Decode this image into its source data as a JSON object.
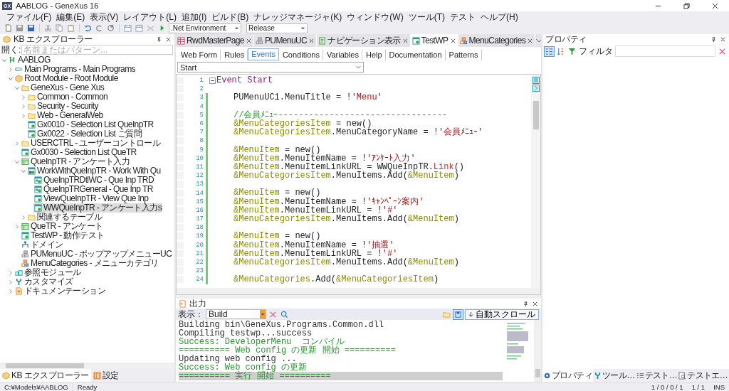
{
  "window": {
    "app_icon": "GX",
    "title": "AABLOG - GeneXus 16"
  },
  "menu": [
    "ファイル(F)",
    "編集(E)",
    "表示(V)",
    "レイアウト(L)",
    "追加(I)",
    "ビルド(B)",
    "ナレッジマネージャ(K)",
    "ウィンドウ(W)",
    "ツール(T)",
    "テスト",
    "ヘルプ(H)"
  ],
  "toolbar": {
    "environment": ".Net Environment",
    "configuration": "Release"
  },
  "kb_explorer": {
    "title": "KB エクスプローラー",
    "search_label": "開く:",
    "search": {
      "placeholder": "名前またはパターン..."
    },
    "tree": [
      {
        "label": "AABLOG",
        "kind": "kb",
        "expanded": true,
        "selected": false,
        "children": [
          {
            "label": "Main Programs - Main Programs",
            "kind": "mainprog",
            "expanded": false,
            "selected": false
          },
          {
            "label": "Root Module - Root Module",
            "kind": "module",
            "expanded": true,
            "selected": false,
            "children": [
              {
                "label": "GeneXus - Gene Xus",
                "kind": "folder",
                "expanded": true,
                "selected": false,
                "children": [
                  {
                    "label": "Common - Common",
                    "kind": "folder",
                    "expanded": false,
                    "selected": false
                  },
                  {
                    "label": "Security - Security",
                    "kind": "folder",
                    "expanded": false,
                    "selected": false
                  },
                  {
                    "label": "Web - GeneralWeb",
                    "kind": "folder",
                    "expanded": false,
                    "selected": false
                  },
                  {
                    "label": "Gx0010 - Selection List QueInpTR",
                    "kind": "webpanel",
                    "selected": false
                  },
                  {
                    "label": "Gx0022 - Selection List ご質問",
                    "kind": "webpanel",
                    "selected": false
                  }
                ]
              },
              {
                "label": "USERCTRL - ユーザーコントロール",
                "kind": "folder",
                "expanded": false,
                "selected": false
              },
              {
                "label": "Gx0030 - Selection List QueTR",
                "kind": "webpanel",
                "selected": false
              },
              {
                "label": "QueInpTR - アンケート入力",
                "kind": "transaction",
                "expanded": true,
                "selected": false,
                "children": [
                  {
                    "label": "WorkWithQueInpTR - Work With Qu",
                    "kind": "pattern",
                    "expanded": true,
                    "selected": false,
                    "children": [
                      {
                        "label": "QueInpTRDtlWC - Que Inp TRD",
                        "kind": "webcomponent",
                        "selected": false
                      },
                      {
                        "label": "QueInpTRGeneral - Que Inp TR",
                        "kind": "webcomponent",
                        "selected": false
                      },
                      {
                        "label": "ViewQueInpTR - View Que Inp",
                        "kind": "webpanel",
                        "selected": false
                      },
                      {
                        "label": "WWQueInpTR - アンケート入力s",
                        "kind": "webpanel",
                        "selected": true
                      }
                    ]
                  },
                  {
                    "label": "関連するテーブル",
                    "kind": "folder",
                    "expanded": false,
                    "selected": false
                  }
                ]
              },
              {
                "label": "QueTR - アンケート",
                "kind": "transaction",
                "expanded": false,
                "selected": false
              },
              {
                "label": "TestWP - 動作テスト",
                "kind": "webpanel",
                "selected": false
              },
              {
                "label": "ドメイン",
                "kind": "domain",
                "selected": false
              },
              {
                "label": "PUMenuUC - ポップアップメニューUC",
                "kind": "uc",
                "selected": false
              },
              {
                "label": "MenuCategories - メニューカテゴリ",
                "kind": "sdt",
                "selected": false
              }
            ]
          },
          {
            "label": "参照モジュール",
            "kind": "refmodule",
            "expanded": false,
            "selected": false
          },
          {
            "label": "カスタマイズ",
            "kind": "customize",
            "expanded": false,
            "selected": false
          },
          {
            "label": "ドキュメンテーション",
            "kind": "doc",
            "expanded": false,
            "selected": false
          }
        ]
      }
    ]
  },
  "left_tabs": [
    {
      "label": "KB エクスプローラー",
      "kind": "kb",
      "selected": true
    },
    {
      "label": "設定",
      "kind": "settings",
      "selected": false
    }
  ],
  "document_tabs": [
    {
      "label": "RwdMasterPage",
      "kind": "masterpage",
      "selected": false
    },
    {
      "label": "PUMenuUC",
      "kind": "uc",
      "selected": false
    },
    {
      "label": "ナビゲーション表示",
      "kind": "navigation",
      "selected": false
    },
    {
      "label": "TestWP",
      "kind": "webpanel",
      "selected": true
    },
    {
      "label": "MenuCategories",
      "kind": "sdt",
      "selected": false
    }
  ],
  "section_tabs": [
    {
      "label": "Web Form",
      "selected": false
    },
    {
      "label": "Rules",
      "selected": false
    },
    {
      "label": "Events",
      "selected": true
    },
    {
      "label": "Conditions",
      "selected": false
    },
    {
      "label": "Variables",
      "selected": false
    },
    {
      "label": "Help",
      "selected": false
    },
    {
      "label": "Documentation",
      "selected": false
    },
    {
      "label": "Patterns",
      "selected": false
    }
  ],
  "event_selector": {
    "value": "Start"
  },
  "code": [
    {
      "number": "1",
      "kind": "header",
      "changed": false,
      "tokens": [
        {
          "kind": "keyword",
          "text": "Event Start"
        }
      ]
    },
    {
      "number": "2",
      "kind": "body",
      "changed": false
    },
    {
      "number": "3",
      "kind": "body",
      "changed": true,
      "tokens": [
        {
          "kind": "plain",
          "text": "PUMenuUC1.MenuTitle = !"
        },
        {
          "kind": "string",
          "text": "'Menu'"
        }
      ]
    },
    {
      "number": "4",
      "kind": "body",
      "changed": true
    },
    {
      "number": "5",
      "kind": "body",
      "changed": true,
      "tokens": [
        {
          "kind": "comment",
          "text": "//会員ﾒﾆｭｰ---------------------------------"
        }
      ]
    },
    {
      "number": "6",
      "kind": "body",
      "changed": true,
      "tokens": [
        {
          "kind": "var",
          "text": "&MenuCategoriesItem"
        },
        {
          "kind": "plain",
          "text": " = new()"
        }
      ]
    },
    {
      "number": "7",
      "kind": "body",
      "changed": true,
      "tokens": [
        {
          "kind": "var",
          "text": "&MenuCategoriesItem"
        },
        {
          "kind": "plain",
          "text": ".MenuCategoryName = !"
        },
        {
          "kind": "string",
          "text": "'会員ﾒﾆｭｰ'"
        }
      ]
    },
    {
      "number": "8",
      "kind": "body",
      "changed": true
    },
    {
      "number": "9",
      "kind": "body",
      "changed": true,
      "tokens": [
        {
          "kind": "var",
          "text": "&MenuItem"
        },
        {
          "kind": "plain",
          "text": " = new()"
        }
      ]
    },
    {
      "number": "10",
      "kind": "body",
      "changed": true,
      "tokens": [
        {
          "kind": "var",
          "text": "&MenuItem"
        },
        {
          "kind": "plain",
          "text": ".MenuItemName = !"
        },
        {
          "kind": "string",
          "text": "'ｱﾝｹｰﾄ入力'"
        }
      ]
    },
    {
      "number": "11",
      "kind": "body",
      "changed": true,
      "tokens": [
        {
          "kind": "var",
          "text": "&MenuItem"
        },
        {
          "kind": "plain",
          "text": ".MenuItemLinkURL = WWQueInpTR."
        },
        {
          "kind": "method",
          "text": "Link"
        },
        {
          "kind": "plain",
          "text": "()"
        }
      ]
    },
    {
      "number": "12",
      "kind": "body",
      "changed": true,
      "tokens": [
        {
          "kind": "var",
          "text": "&MenuCategoriesItem"
        },
        {
          "kind": "plain",
          "text": ".MenuItems.Add("
        },
        {
          "kind": "var",
          "text": "&MenuItem"
        },
        {
          "kind": "plain",
          "text": ")"
        }
      ]
    },
    {
      "number": "13",
      "kind": "body",
      "changed": true
    },
    {
      "number": "14",
      "kind": "body",
      "changed": true,
      "tokens": [
        {
          "kind": "var",
          "text": "&MenuItem"
        },
        {
          "kind": "plain",
          "text": " = new()"
        }
      ]
    },
    {
      "number": "15",
      "kind": "body",
      "changed": true,
      "tokens": [
        {
          "kind": "var",
          "text": "&MenuItem"
        },
        {
          "kind": "plain",
          "text": ".MenuItemName = !"
        },
        {
          "kind": "string",
          "text": "'ｷｬﾝﾍﾟｰﾝ案内'"
        }
      ]
    },
    {
      "number": "16",
      "kind": "body",
      "changed": true,
      "tokens": [
        {
          "kind": "var",
          "text": "&MenuItem"
        },
        {
          "kind": "plain",
          "text": ".MenuItemLinkURL = !"
        },
        {
          "kind": "string",
          "text": "'#'"
        }
      ]
    },
    {
      "number": "17",
      "kind": "body",
      "changed": true,
      "tokens": [
        {
          "kind": "var",
          "text": "&MenuCategoriesItem"
        },
        {
          "kind": "plain",
          "text": ".MenuItems.Add("
        },
        {
          "kind": "var",
          "text": "&MenuItem"
        },
        {
          "kind": "plain",
          "text": ")"
        }
      ]
    },
    {
      "number": "18",
      "kind": "body",
      "changed": true
    },
    {
      "number": "19",
      "kind": "body",
      "changed": true,
      "tokens": [
        {
          "kind": "var",
          "text": "&MenuItem"
        },
        {
          "kind": "plain",
          "text": " = new()"
        }
      ]
    },
    {
      "number": "20",
      "kind": "body",
      "changed": true,
      "tokens": [
        {
          "kind": "var",
          "text": "&MenuItem"
        },
        {
          "kind": "plain",
          "text": ".MenuItemName = !"
        },
        {
          "kind": "string",
          "text": "'抽選'"
        }
      ]
    },
    {
      "number": "21",
      "kind": "body",
      "changed": true,
      "tokens": [
        {
          "kind": "var",
          "text": "&MenuItem"
        },
        {
          "kind": "plain",
          "text": ".MenuItemLinkURL = !"
        },
        {
          "kind": "string",
          "text": "'#'"
        }
      ]
    },
    {
      "number": "22",
      "kind": "body",
      "changed": true,
      "tokens": [
        {
          "kind": "var",
          "text": "&MenuCategoriesItem"
        },
        {
          "kind": "plain",
          "text": ".MenuItems.Add("
        },
        {
          "kind": "var",
          "text": "&MenuItem"
        },
        {
          "kind": "plain",
          "text": ")"
        }
      ]
    },
    {
      "number": "23",
      "kind": "body",
      "changed": true
    },
    {
      "number": "24",
      "kind": "body",
      "changed": true,
      "tokens": [
        {
          "kind": "var",
          "text": "&MenuCategories"
        },
        {
          "kind": "plain",
          "text": ".Add("
        },
        {
          "kind": "var",
          "text": "&MenuCategoriesItem"
        },
        {
          "kind": "plain",
          "text": ")"
        }
      ]
    }
  ],
  "output": {
    "title": "出力",
    "show_label": "表示：",
    "source": "Build",
    "auto_scroll": "自動スクロール",
    "lines": [
      {
        "text": "Building bin\\GeneXus.Programs.Common.dll",
        "kind": "plain",
        "selected": false
      },
      {
        "text": "Compiling testwp...success",
        "kind": "plain",
        "selected": false
      },
      {
        "text": "Success: DeveloperMenu  コンパイル",
        "kind": "success",
        "selected": false
      },
      {
        "text": "========== Web config の更新 開始 ==========",
        "kind": "success",
        "selected": false
      },
      {
        "text": "Updating web config ...",
        "kind": "plain",
        "selected": false
      },
      {
        "text": "Success: Web config の更新",
        "kind": "success",
        "selected": false
      },
      {
        "text": "========== 実行 開始 ==========",
        "kind": "success",
        "selected": true
      }
    ]
  },
  "properties": {
    "title": "プロパティ",
    "filter_label": "フィルタ"
  },
  "right_tabs": [
    {
      "label": "プロパティ",
      "kind": "properties",
      "selected": true
    },
    {
      "label": "ツール…",
      "kind": "tools",
      "selected": false
    },
    {
      "label": "テスト…",
      "kind": "tests",
      "selected": false
    },
    {
      "label": "テストエ…",
      "kind": "explorer",
      "selected": false
    }
  ],
  "status_bar": {
    "path": "C:¥Models¥AABLOG",
    "state": "Ready",
    "counts": "1 / 0 / 0 / 1",
    "position": "1 / 1",
    "mode": "INS"
  }
}
